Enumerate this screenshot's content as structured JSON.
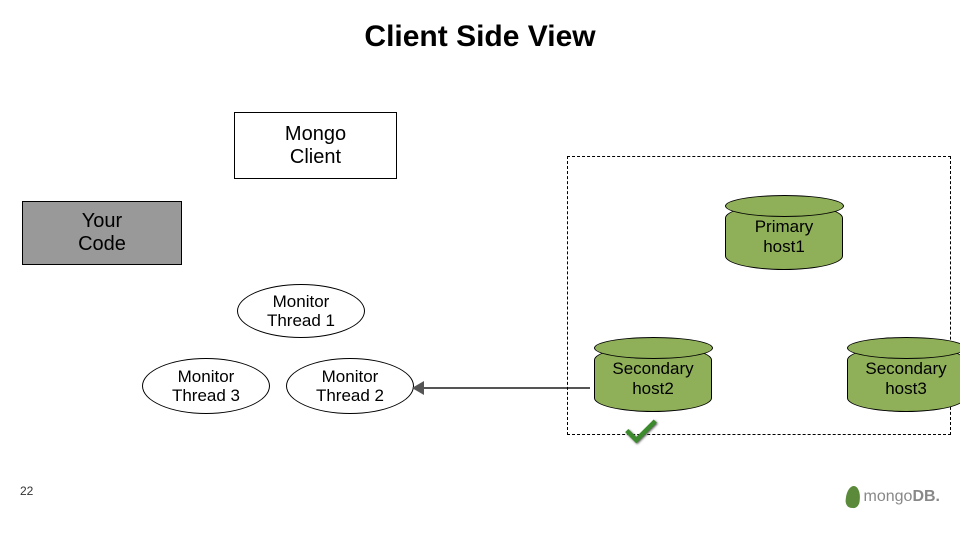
{
  "title": "Client Side View",
  "boxes": {
    "mongo_client": "Mongo\nClient",
    "your_code": "Your\nCode"
  },
  "monitors": {
    "m1": "Monitor\nThread 1",
    "m2": "Monitor\nThread 2",
    "m3": "Monitor\nThread 3"
  },
  "hosts": {
    "primary": "Primary\nhost1",
    "secondary2": "Secondary\nhost2",
    "secondary3": "Secondary\nhost3"
  },
  "page_number": "22",
  "logo": {
    "text1": "mongo",
    "text2": "DB."
  }
}
